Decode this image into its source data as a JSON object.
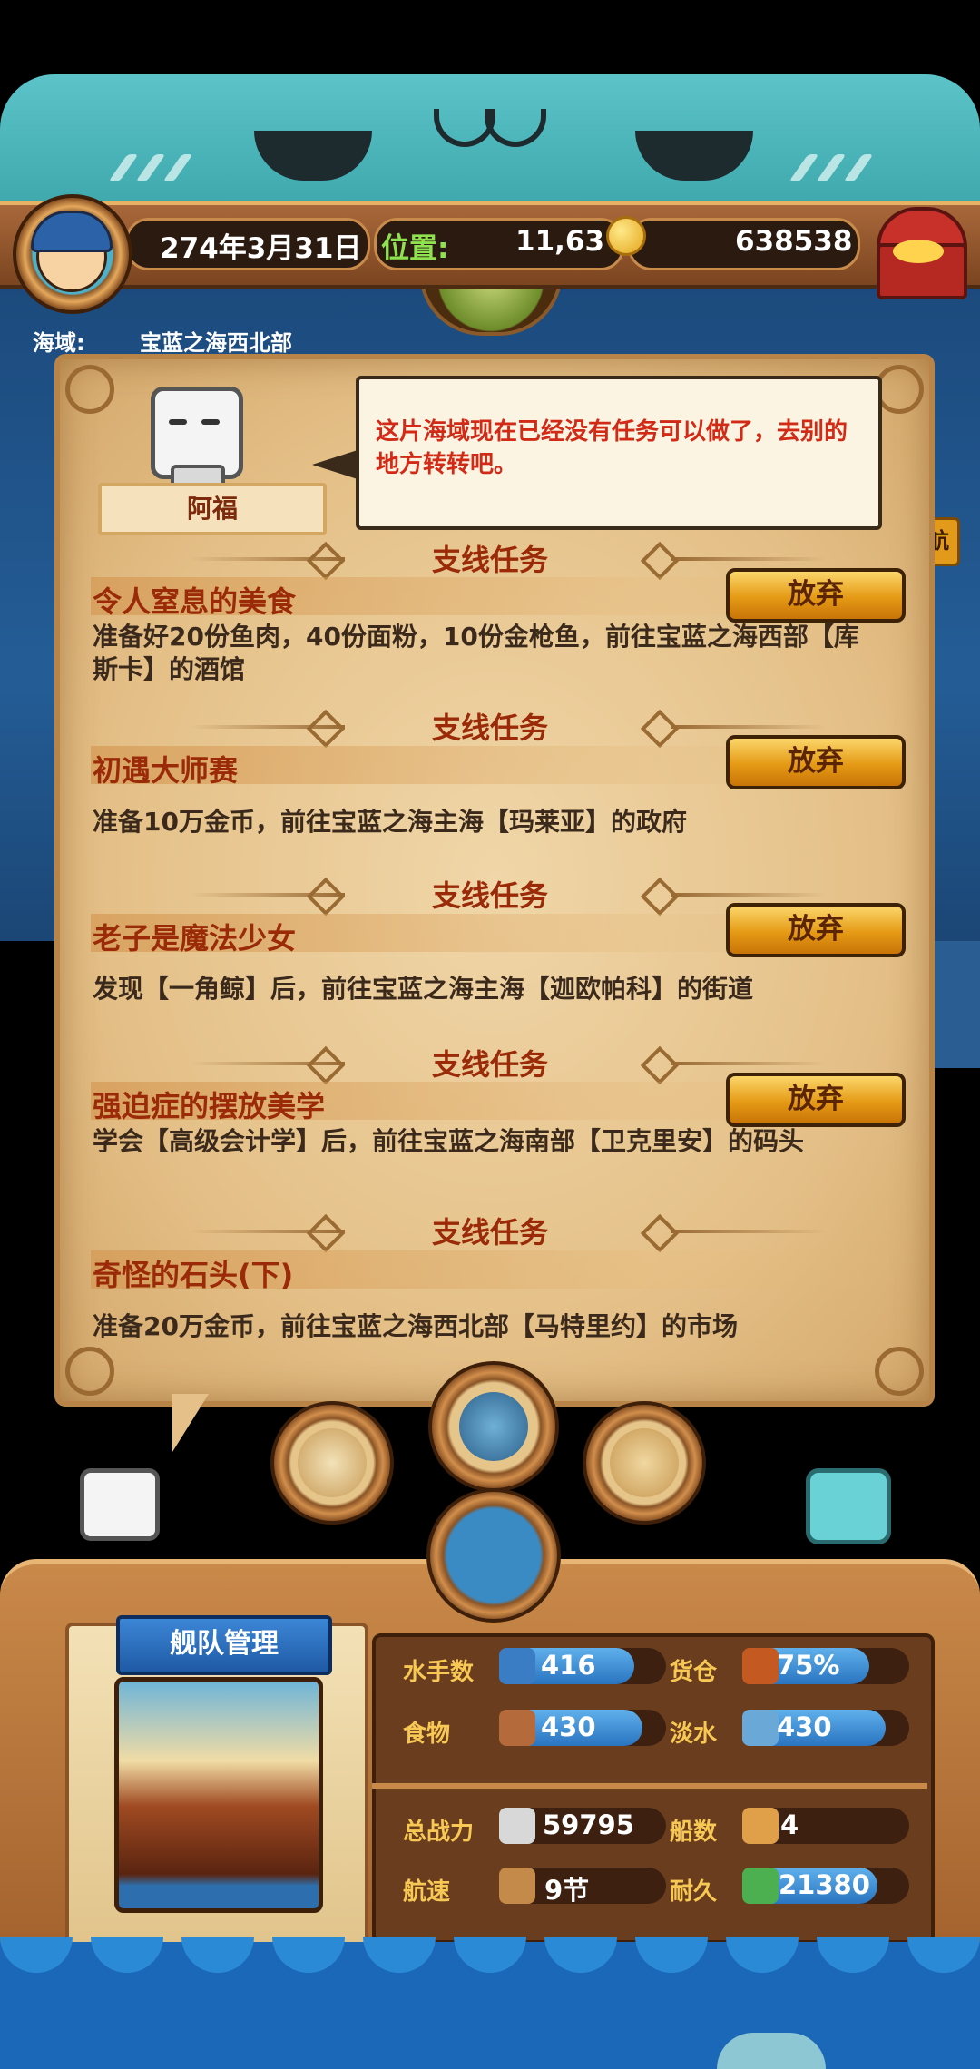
{
  "header": {
    "date": "274年3月31日",
    "location_label": "位置:",
    "location_value": "11,63",
    "gold": "638538"
  },
  "sea": {
    "label": "海域:",
    "value": "宝蓝之海西北部",
    "side_button": "航"
  },
  "npc": {
    "name": "阿福",
    "speech": "这片海域现在已经没有任务可以做了，去别的地方转转吧。"
  },
  "quests": [
    {
      "section": "支线任务",
      "title": "令人窒息的美食",
      "desc": "准备好20份鱼肉，40份面粉，10份金枪鱼，前往宝蓝之海西部【库斯卡】的酒馆",
      "action": "放弃"
    },
    {
      "section": "支线任务",
      "title": "初遇大师赛",
      "desc": "准备10万金币，前往宝蓝之海主海【玛莱亚】的政府",
      "action": "放弃"
    },
    {
      "section": "支线任务",
      "title": "老子是魔法少女",
      "desc": "发现【一角鲸】后，前往宝蓝之海主海【迦欧帕科】的街道",
      "action": "放弃"
    },
    {
      "section": "支线任务",
      "title": "强迫症的摆放美学",
      "desc": "学会【高级会计学】后，前往宝蓝之海南部【卫克里安】的码头",
      "action": "放弃"
    },
    {
      "section": "支线任务",
      "title": "奇怪的石头(下)",
      "desc": "准备20万金币，前往宝蓝之海西北部【马特里约】的市场"
    }
  ],
  "fleet": {
    "title": "舰队管理",
    "stats": [
      {
        "label": "水手数",
        "value": "416",
        "fill": 0.8,
        "icon": "sailor-icon",
        "color": "#3a7dc4"
      },
      {
        "label": "货仓",
        "value": "75%",
        "fill": 0.75,
        "icon": "cargo-icon",
        "color": "#c45a22"
      },
      {
        "label": "食物",
        "value": "430",
        "fill": 0.85,
        "icon": "meat-icon",
        "color": "#b46a3a"
      },
      {
        "label": "淡水",
        "value": "430",
        "fill": 0.85,
        "icon": "water-jug-icon",
        "color": "#6aa8d8"
      },
      {
        "label": "总战力",
        "value": "59795",
        "fill": 0.0,
        "icon": "crossed-swords-icon",
        "color": "#d8d8d8"
      },
      {
        "label": "船数",
        "value": "4",
        "fill": 0.0,
        "icon": "ship-count-icon",
        "color": "#e0a04a"
      },
      {
        "label": "航速",
        "value": "9节",
        "fill": 0.0,
        "icon": "speed-sail-icon",
        "color": "#c48a4a"
      },
      {
        "label": "耐久",
        "value": "21380",
        "fill": 0.8,
        "icon": "durability-icon",
        "color": "#4caf50"
      }
    ]
  }
}
